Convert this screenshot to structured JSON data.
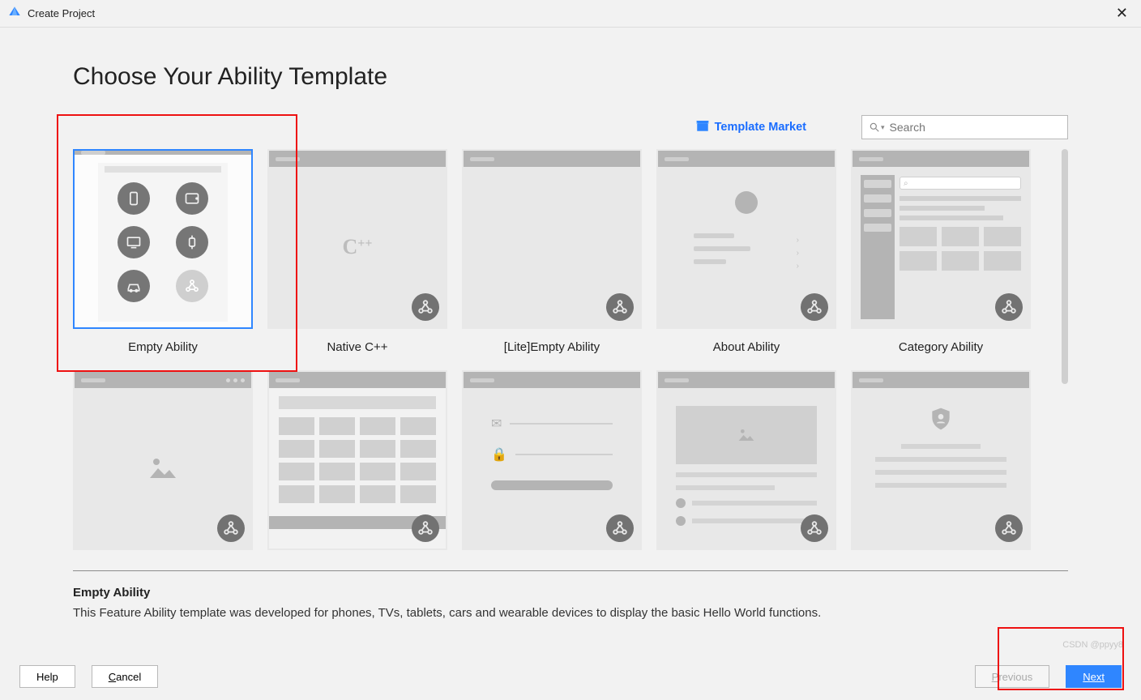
{
  "window": {
    "title": "Create Project"
  },
  "heading": "Choose Your Ability Template",
  "market_link": "Template Market",
  "search": {
    "placeholder": "Search"
  },
  "templates": [
    {
      "label": "Empty Ability",
      "selected": true
    },
    {
      "label": "Native C++"
    },
    {
      "label": "[Lite]Empty Ability"
    },
    {
      "label": "About Ability"
    },
    {
      "label": "Category Ability"
    }
  ],
  "selected": {
    "title": "Empty Ability",
    "description": "This Feature Ability template was developed for phones, TVs, tablets, cars and wearable devices to display the basic Hello World functions."
  },
  "buttons": {
    "help": "Help",
    "cancel": "Cancel",
    "previous": "Previous",
    "next": "Next"
  },
  "watermark": "CSDN @ppyy8"
}
